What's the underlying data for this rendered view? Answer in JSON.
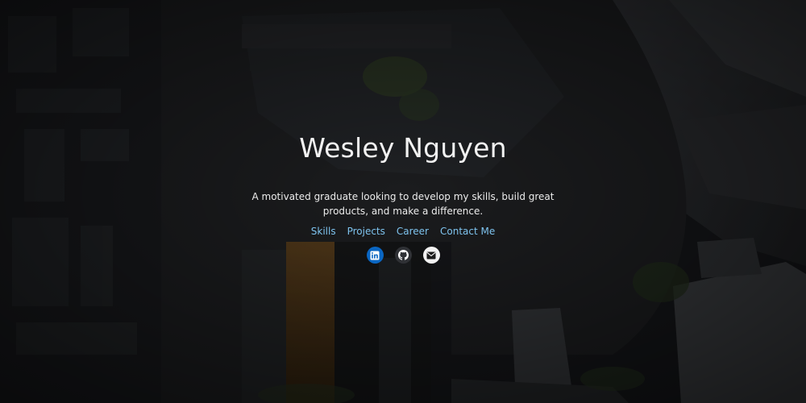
{
  "hero": {
    "name": "Wesley Nguyen",
    "tagline": "A motivated graduate looking to develop my skills, build great products, and make a difference."
  },
  "nav": {
    "items": [
      {
        "label": "Skills"
      },
      {
        "label": "Projects"
      },
      {
        "label": "Career"
      },
      {
        "label": "Contact Me"
      }
    ]
  },
  "social": {
    "links": [
      {
        "icon": "linkedin-icon",
        "color": "#0a66c2"
      },
      {
        "icon": "github-icon",
        "color": "#2f3135"
      },
      {
        "icon": "email-icon",
        "color": "#f2f2f2"
      }
    ]
  },
  "colors": {
    "nav_link": "#7ec3ee",
    "heading": "#f2f2f2"
  }
}
